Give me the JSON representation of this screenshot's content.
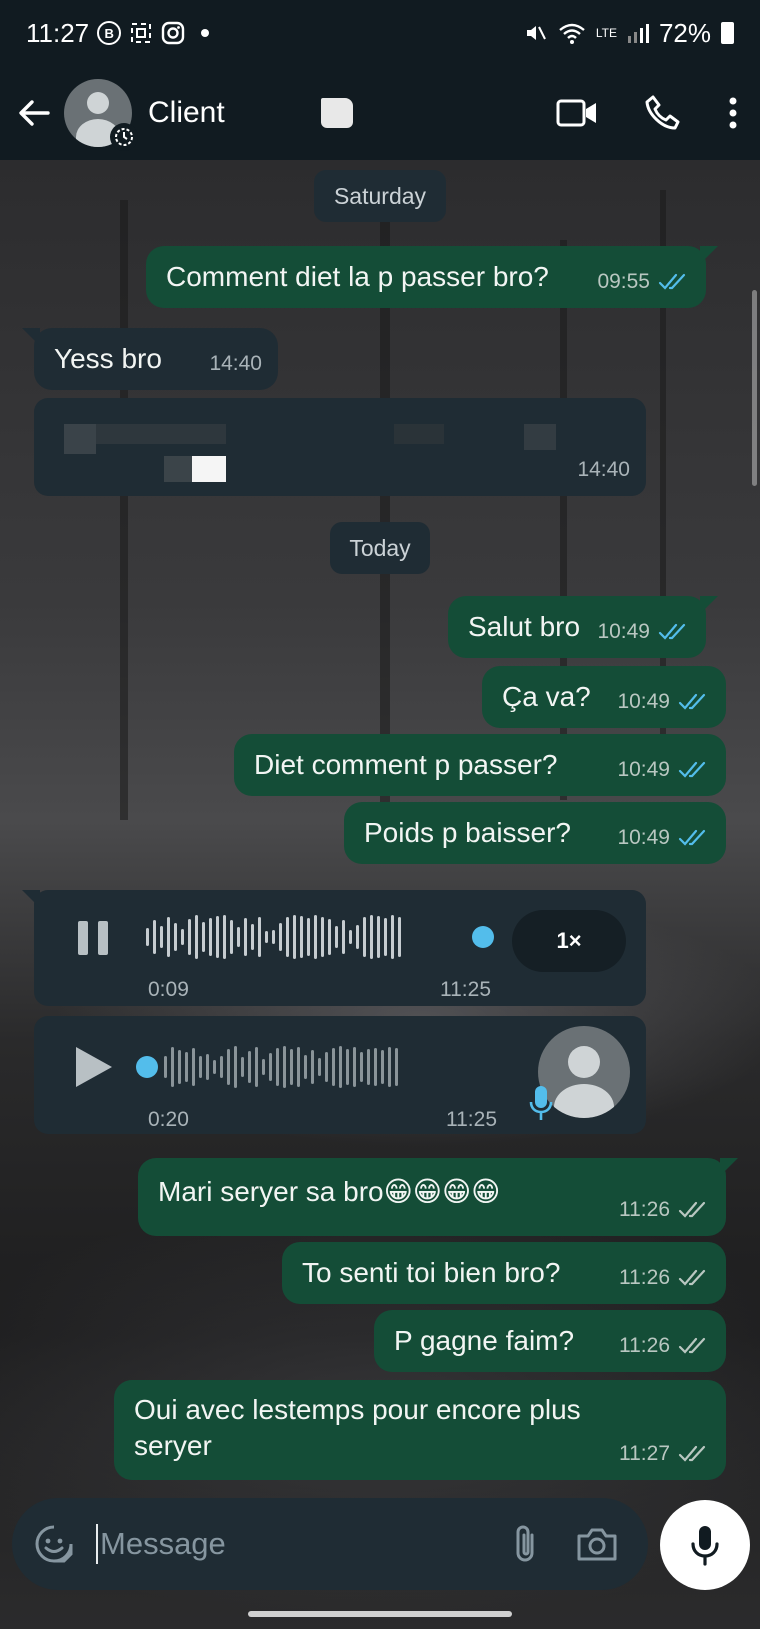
{
  "status_bar": {
    "time": "11:27",
    "battery": "72%",
    "network": "LTE"
  },
  "header": {
    "contact_name": "Client",
    "icons": [
      "back-arrow-icon",
      "video-call-icon",
      "phone-icon",
      "more-vert-icon"
    ]
  },
  "chat": {
    "date_saturday": "Saturday",
    "date_today": "Today",
    "messages": [
      {
        "dir": "out",
        "text": "Comment diet la p passer bro?",
        "time": "09:55",
        "status": "read"
      },
      {
        "dir": "in",
        "text": "Yess bro",
        "time": "14:40"
      },
      {
        "dir": "in",
        "text": "",
        "time": "14:40"
      },
      {
        "dir": "out",
        "text": "Salut bro",
        "time": "10:49",
        "status": "read"
      },
      {
        "dir": "out",
        "text": "Ça va?",
        "time": "10:49",
        "status": "read"
      },
      {
        "dir": "out",
        "text": "Diet comment p passer?",
        "time": "10:49",
        "status": "read"
      },
      {
        "dir": "out",
        "text": "Poids p baisser?",
        "time": "10:49",
        "status": "read"
      },
      {
        "dir": "out",
        "text": "Mari seryer sa bro😁😁😁😁",
        "time": "11:26",
        "status": "delivered"
      },
      {
        "dir": "out",
        "text": "To senti toi bien bro?",
        "time": "11:26",
        "status": "delivered"
      },
      {
        "dir": "out",
        "text": "P gagne faim?",
        "time": "11:26",
        "status": "delivered"
      },
      {
        "dir": "out",
        "text": "Oui avec lestemps pour encore plus seryer",
        "time": "11:27",
        "status": "delivered"
      }
    ],
    "voice_1": {
      "elapsed": "0:09",
      "time": "11:25",
      "speed": "1×",
      "state": "playing",
      "progress": 1.0
    },
    "voice_2": {
      "elapsed": "0:20",
      "time": "11:25",
      "state": "paused",
      "progress": 0.0
    }
  },
  "input": {
    "placeholder": "Message",
    "icons": [
      "sticker-icon",
      "attach-icon",
      "camera-icon",
      "mic-icon"
    ]
  },
  "colors": {
    "outgoing_bubble": "#144d37",
    "incoming_bubble": "#1f2c34",
    "read_tick": "#53bdeb",
    "header_bg": "#111b21"
  }
}
